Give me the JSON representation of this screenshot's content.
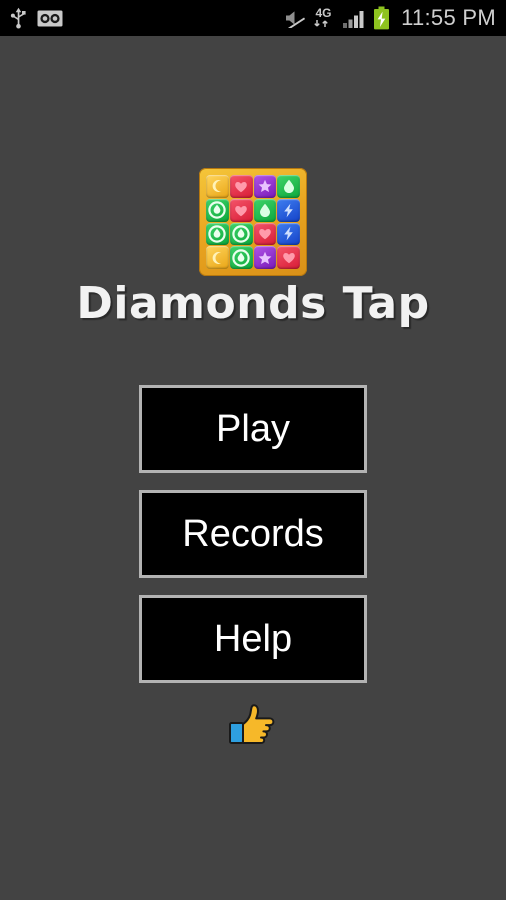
{
  "status_bar": {
    "clock": "11:55 PM",
    "background_color": "#000000",
    "text_color": "#cfcfcf",
    "left_icons": [
      {
        "name": "usb-icon",
        "label": "USB"
      },
      {
        "name": "voicemail-icon",
        "label": "Voicemail"
      }
    ],
    "right_icons": [
      {
        "name": "mute-icon",
        "label": "Silent mode"
      },
      {
        "name": "network-4g-icon",
        "label": "4G"
      },
      {
        "name": "signal-bars-icon",
        "label": "Signal"
      },
      {
        "name": "battery-charging-icon",
        "label": "Battery charging",
        "color": "#8ec31f"
      }
    ]
  },
  "app": {
    "title": "Diamonds Tap",
    "background_color": "#434343",
    "title_color": "#f2f2f2"
  },
  "icon": {
    "border_color": "#e8a41f",
    "rows": [
      [
        {
          "color": "orange",
          "symbol": "moon"
        },
        {
          "color": "red",
          "symbol": "heart"
        },
        {
          "color": "purple",
          "symbol": "star"
        },
        {
          "color": "green",
          "symbol": "drop"
        }
      ],
      [
        {
          "color": "green",
          "symbol": "ring"
        },
        {
          "color": "red",
          "symbol": "heart"
        },
        {
          "color": "green",
          "symbol": "drop"
        },
        {
          "color": "blue",
          "symbol": "bolt"
        }
      ],
      [
        {
          "color": "green",
          "symbol": "ring"
        },
        {
          "color": "green",
          "symbol": "ring"
        },
        {
          "color": "red",
          "symbol": "heart"
        },
        {
          "color": "blue",
          "symbol": "bolt"
        }
      ],
      [
        {
          "color": "orange",
          "symbol": "moon"
        },
        {
          "color": "green",
          "symbol": "ring"
        },
        {
          "color": "purple",
          "symbol": "star"
        },
        {
          "color": "red",
          "symbol": "heart"
        }
      ]
    ]
  },
  "menu": {
    "buttons": [
      {
        "name": "play-button",
        "label": "Play"
      },
      {
        "name": "records-button",
        "label": "Records"
      },
      {
        "name": "help-button",
        "label": "Help"
      }
    ],
    "button_background": "#000000",
    "button_border": "#b3b3b3",
    "button_text_color": "#ffffff"
  },
  "footer": {
    "emoji_name": "thumbs-up-icon",
    "emoji_label": "Thumbs up"
  }
}
